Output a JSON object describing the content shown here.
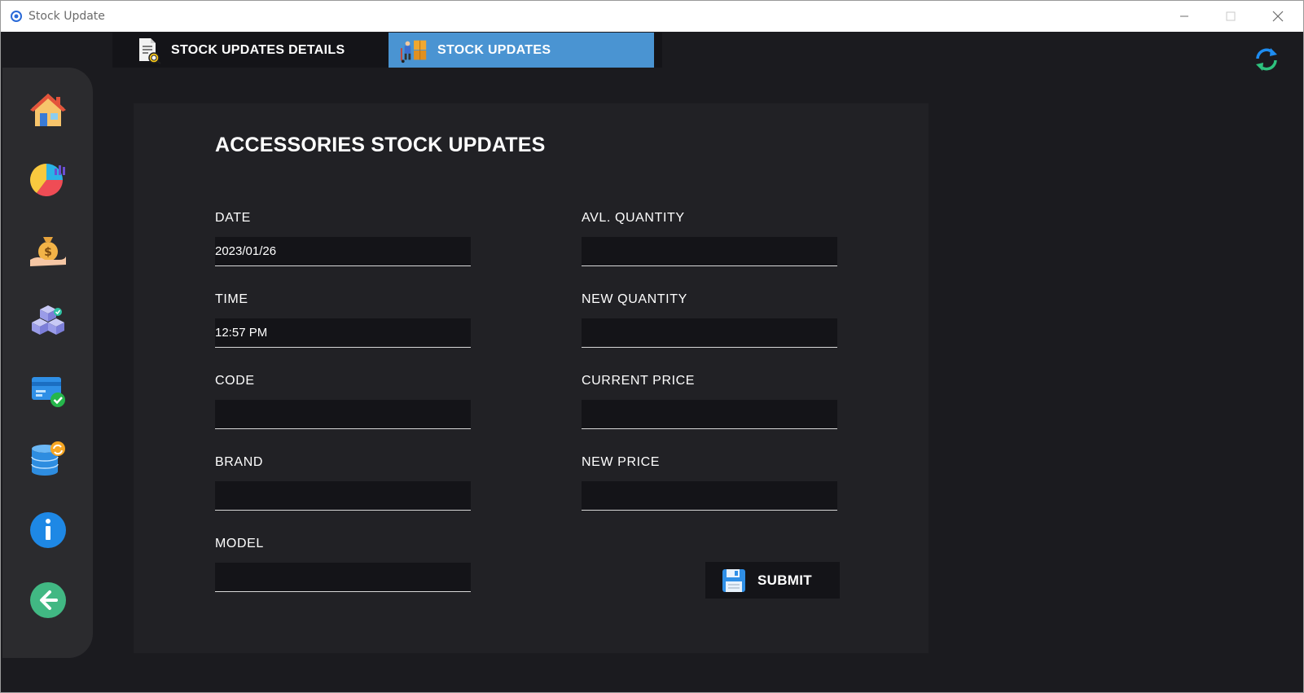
{
  "window": {
    "title": "Stock Update",
    "minimize_label": "—",
    "maximize_label": "☐",
    "close_label": "✕"
  },
  "tabs": [
    {
      "label": "STOCK UPDATES DETAILS",
      "icon": "document-search-icon",
      "active": false
    },
    {
      "label": "STOCK UPDATES",
      "icon": "delivery-boxes-icon",
      "active": true
    }
  ],
  "sidebar": {
    "items": [
      {
        "name": "home",
        "icon": "home-icon"
      },
      {
        "name": "dashboard",
        "icon": "chart-icon"
      },
      {
        "name": "sales",
        "icon": "money-bag-icon"
      },
      {
        "name": "stock",
        "icon": "boxes-icon"
      },
      {
        "name": "payments",
        "icon": "card-check-icon"
      },
      {
        "name": "database",
        "icon": "database-sync-icon"
      },
      {
        "name": "about",
        "icon": "info-icon"
      },
      {
        "name": "back",
        "icon": "back-arrow-icon"
      }
    ]
  },
  "form": {
    "title": "ACCESSORIES STOCK UPDATES",
    "date": {
      "label": "DATE",
      "value": "2023/01/26"
    },
    "time": {
      "label": "TIME",
      "value": "12:57 PM"
    },
    "code": {
      "label": "CODE",
      "value": ""
    },
    "brand": {
      "label": "BRAND",
      "value": ""
    },
    "model": {
      "label": "MODEL",
      "value": ""
    },
    "avl_quantity": {
      "label": "AVL. QUANTITY",
      "value": ""
    },
    "new_quantity": {
      "label": "NEW QUANTITY",
      "value": ""
    },
    "current_price": {
      "label": "CURRENT PRICE",
      "value": ""
    },
    "new_price": {
      "label": "NEW PRICE",
      "value": ""
    },
    "submit_label": "SUBMIT"
  },
  "colors": {
    "background": "#1b1b1f",
    "panel": "#212125",
    "input": "#141418",
    "active_tab": "#4a94d2",
    "sidebar": "#2b2b2e"
  }
}
